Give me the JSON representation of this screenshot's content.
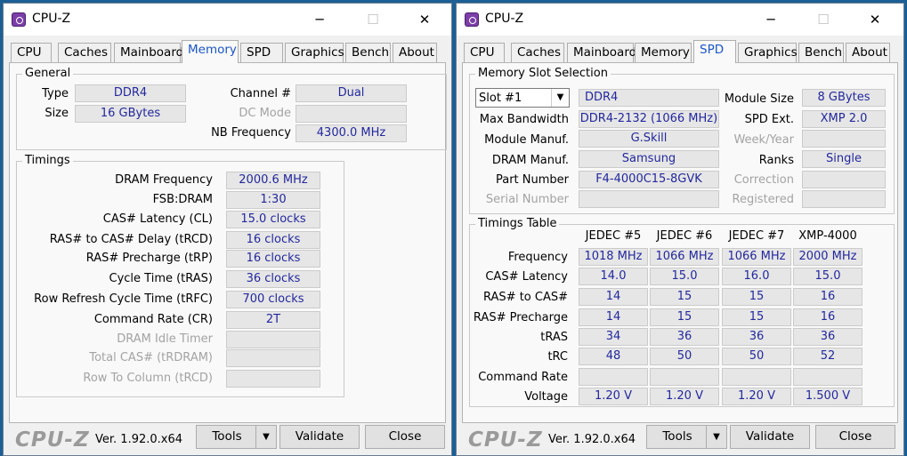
{
  "w1": {
    "title": "CPU-Z",
    "tabs": [
      "CPU",
      "Caches",
      "Mainboard",
      "Memory",
      "SPD",
      "Graphics",
      "Bench",
      "About"
    ],
    "general": {
      "title": "General",
      "type_label": "Type",
      "type_value": "DDR4",
      "size_label": "Size",
      "size_value": "16 GBytes",
      "channel_label": "Channel #",
      "channel_value": "Dual",
      "dcmode_label": "DC Mode",
      "dcmode_value": "",
      "nbfreq_label": "NB Frequency",
      "nbfreq_value": "4300.0 MHz"
    },
    "timings": {
      "title": "Timings",
      "rows": [
        {
          "label": "DRAM Frequency",
          "value": "2000.6 MHz"
        },
        {
          "label": "FSB:DRAM",
          "value": "1:30"
        },
        {
          "label": "CAS# Latency (CL)",
          "value": "15.0 clocks"
        },
        {
          "label": "RAS# to CAS# Delay (tRCD)",
          "value": "16 clocks"
        },
        {
          "label": "RAS# Precharge (tRP)",
          "value": "16 clocks"
        },
        {
          "label": "Cycle Time (tRAS)",
          "value": "36 clocks"
        },
        {
          "label": "Row Refresh Cycle Time (tRFC)",
          "value": "700 clocks"
        },
        {
          "label": "Command Rate (CR)",
          "value": "2T"
        },
        {
          "label": "DRAM Idle Timer",
          "value": ""
        },
        {
          "label": "Total CAS# (tRDRAM)",
          "value": ""
        },
        {
          "label": "Row To Column (tRCD)",
          "value": ""
        }
      ]
    },
    "footer": {
      "brand": "CPU-Z",
      "version": "Ver. 1.92.0.x64",
      "tools": "Tools",
      "validate": "Validate",
      "close": "Close"
    }
  },
  "w2": {
    "title": "CPU-Z",
    "tabs": [
      "CPU",
      "Caches",
      "Mainboard",
      "Memory",
      "SPD",
      "Graphics",
      "Bench",
      "About"
    ],
    "slot": {
      "title": "Memory Slot Selection",
      "selected": "Slot #1",
      "type_value": "DDR4",
      "module_size_label": "Module Size",
      "module_size_value": "8 GBytes",
      "max_bw_label": "Max Bandwidth",
      "max_bw_value": "DDR4-2132 (1066 MHz)",
      "spd_ext_label": "SPD Ext.",
      "spd_ext_value": "XMP 2.0",
      "module_manuf_label": "Module Manuf.",
      "module_manuf_value": "G.Skill",
      "weekyear_label": "Week/Year",
      "weekyear_value": "",
      "dram_manuf_label": "DRAM Manuf.",
      "dram_manuf_value": "Samsung",
      "ranks_label": "Ranks",
      "ranks_value": "Single",
      "part_label": "Part Number",
      "part_value": "F4-4000C15-8GVK",
      "correction_label": "Correction",
      "correction_value": "",
      "serial_label": "Serial Number",
      "serial_value": "",
      "registered_label": "Registered",
      "registered_value": ""
    },
    "timings_table": {
      "title": "Timings Table",
      "columns": [
        "JEDEC #5",
        "JEDEC #6",
        "JEDEC #7",
        "XMP-4000"
      ],
      "rows": [
        {
          "label": "Frequency",
          "values": [
            "1018 MHz",
            "1066 MHz",
            "1066 MHz",
            "2000 MHz"
          ]
        },
        {
          "label": "CAS# Latency",
          "values": [
            "14.0",
            "15.0",
            "16.0",
            "15.0"
          ]
        },
        {
          "label": "RAS# to CAS#",
          "values": [
            "14",
            "15",
            "15",
            "16"
          ]
        },
        {
          "label": "RAS# Precharge",
          "values": [
            "14",
            "15",
            "15",
            "16"
          ]
        },
        {
          "label": "tRAS",
          "values": [
            "34",
            "36",
            "36",
            "36"
          ]
        },
        {
          "label": "tRC",
          "values": [
            "48",
            "50",
            "50",
            "52"
          ]
        },
        {
          "label": "Command Rate",
          "values": [
            "",
            "",
            "",
            ""
          ]
        },
        {
          "label": "Voltage",
          "values": [
            "1.20 V",
            "1.20 V",
            "1.20 V",
            "1.500 V"
          ]
        }
      ]
    },
    "footer": {
      "brand": "CPU-Z",
      "version": "Ver. 1.92.0.x64",
      "tools": "Tools",
      "validate": "Validate",
      "close": "Close"
    }
  }
}
